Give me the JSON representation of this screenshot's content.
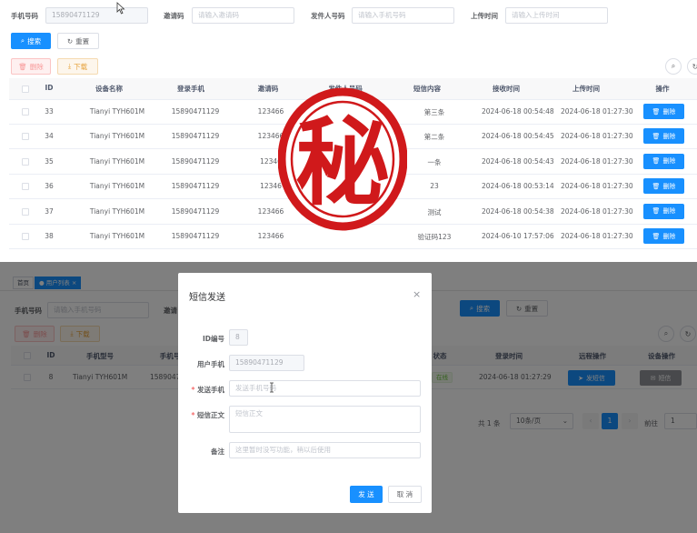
{
  "filters": {
    "phone": {
      "label": "手机号码",
      "value": "15890471129"
    },
    "invite": {
      "label": "邀请码",
      "placeholder": "请输入邀请码"
    },
    "sender": {
      "label": "发件人号码",
      "placeholder": "请输入手机号码"
    },
    "upload": {
      "label": "上传时间",
      "placeholder": "请输入上传时间"
    }
  },
  "actions": {
    "search": "搜索",
    "reset": "重置",
    "delete": "删除",
    "download": "下载"
  },
  "table": {
    "headers": [
      "ID",
      "设备名称",
      "登录手机",
      "邀请码",
      "发件人号码",
      "短信内容",
      "接收时间",
      "上传时间",
      "操作"
    ],
    "rows": [
      {
        "id": "33",
        "device": "Tianyi TYH601M",
        "phone": "15890471129",
        "invite": "123466",
        "content": "第三条",
        "recv": "2024-06-18 00:54:48",
        "upload": "2024-06-18 01:27:30",
        "op": "删除"
      },
      {
        "id": "34",
        "device": "Tianyi TYH601M",
        "phone": "15890471129",
        "invite": "123466",
        "content": "第二条",
        "recv": "2024-06-18 00:54:45",
        "upload": "2024-06-18 01:27:30",
        "op": "删除"
      },
      {
        "id": "35",
        "device": "Tianyi TYH601M",
        "phone": "15890471129",
        "invite": "12346",
        "content": "一条",
        "recv": "2024-06-18 00:54:43",
        "upload": "2024-06-18 01:27:30",
        "op": "删除"
      },
      {
        "id": "36",
        "device": "Tianyi TYH601M",
        "phone": "15890471129",
        "invite": "12346",
        "content": "23",
        "recv": "2024-06-18 00:53:14",
        "upload": "2024-06-18 01:27:30",
        "op": "删除"
      },
      {
        "id": "37",
        "device": "Tianyi TYH601M",
        "phone": "15890471129",
        "invite": "123466",
        "content": "测试",
        "recv": "2024-06-18 00:54:38",
        "upload": "2024-06-18 01:27:30",
        "op": "删除"
      },
      {
        "id": "38",
        "device": "Tianyi TYH601M",
        "phone": "15890471129",
        "invite": "123466",
        "content": "验证码123",
        "recv": "2024-06-10 17:57:06",
        "upload": "2024-06-18 01:27:30",
        "op": "删除"
      }
    ]
  },
  "stamp": {
    "char": "秘",
    "color": "#d0191b"
  },
  "bottom": {
    "tabs": [
      "首页",
      "用户列表"
    ],
    "filter_label": "手机号码",
    "filter_placeholder": "请输入手机号码",
    "invite_label": "邀请",
    "search": "搜索",
    "reset": "重置",
    "delete": "删除",
    "download": "下载",
    "headers": [
      "ID",
      "手机型号",
      "手机号",
      "状态",
      "登录时间",
      "远程操作",
      "设备操作"
    ],
    "row": {
      "id": "8",
      "model": "Tianyi TYH601M",
      "phone": "1589047",
      "status": "在线",
      "time": "2024-06-18 01:27:29",
      "send": "发短信",
      "sms": "短信"
    },
    "pagination": {
      "total": "共 1 条",
      "size": "10条/页",
      "page": "1",
      "goto": "前往",
      "goto_value": "1"
    }
  },
  "dialog": {
    "title": "短信发送",
    "id_label": "ID编号",
    "id_value": "8",
    "user_phone_label": "用户手机",
    "user_phone_value": "15890471129",
    "send_phone_label": "发送手机",
    "send_phone_placeholder": "发送手机号码",
    "body_label": "短信正文",
    "body_placeholder": "短信正文",
    "note_label": "备注",
    "note_placeholder": "这里暂时没写功能，稍以后使用",
    "send": "发 送",
    "cancel": "取 消"
  }
}
